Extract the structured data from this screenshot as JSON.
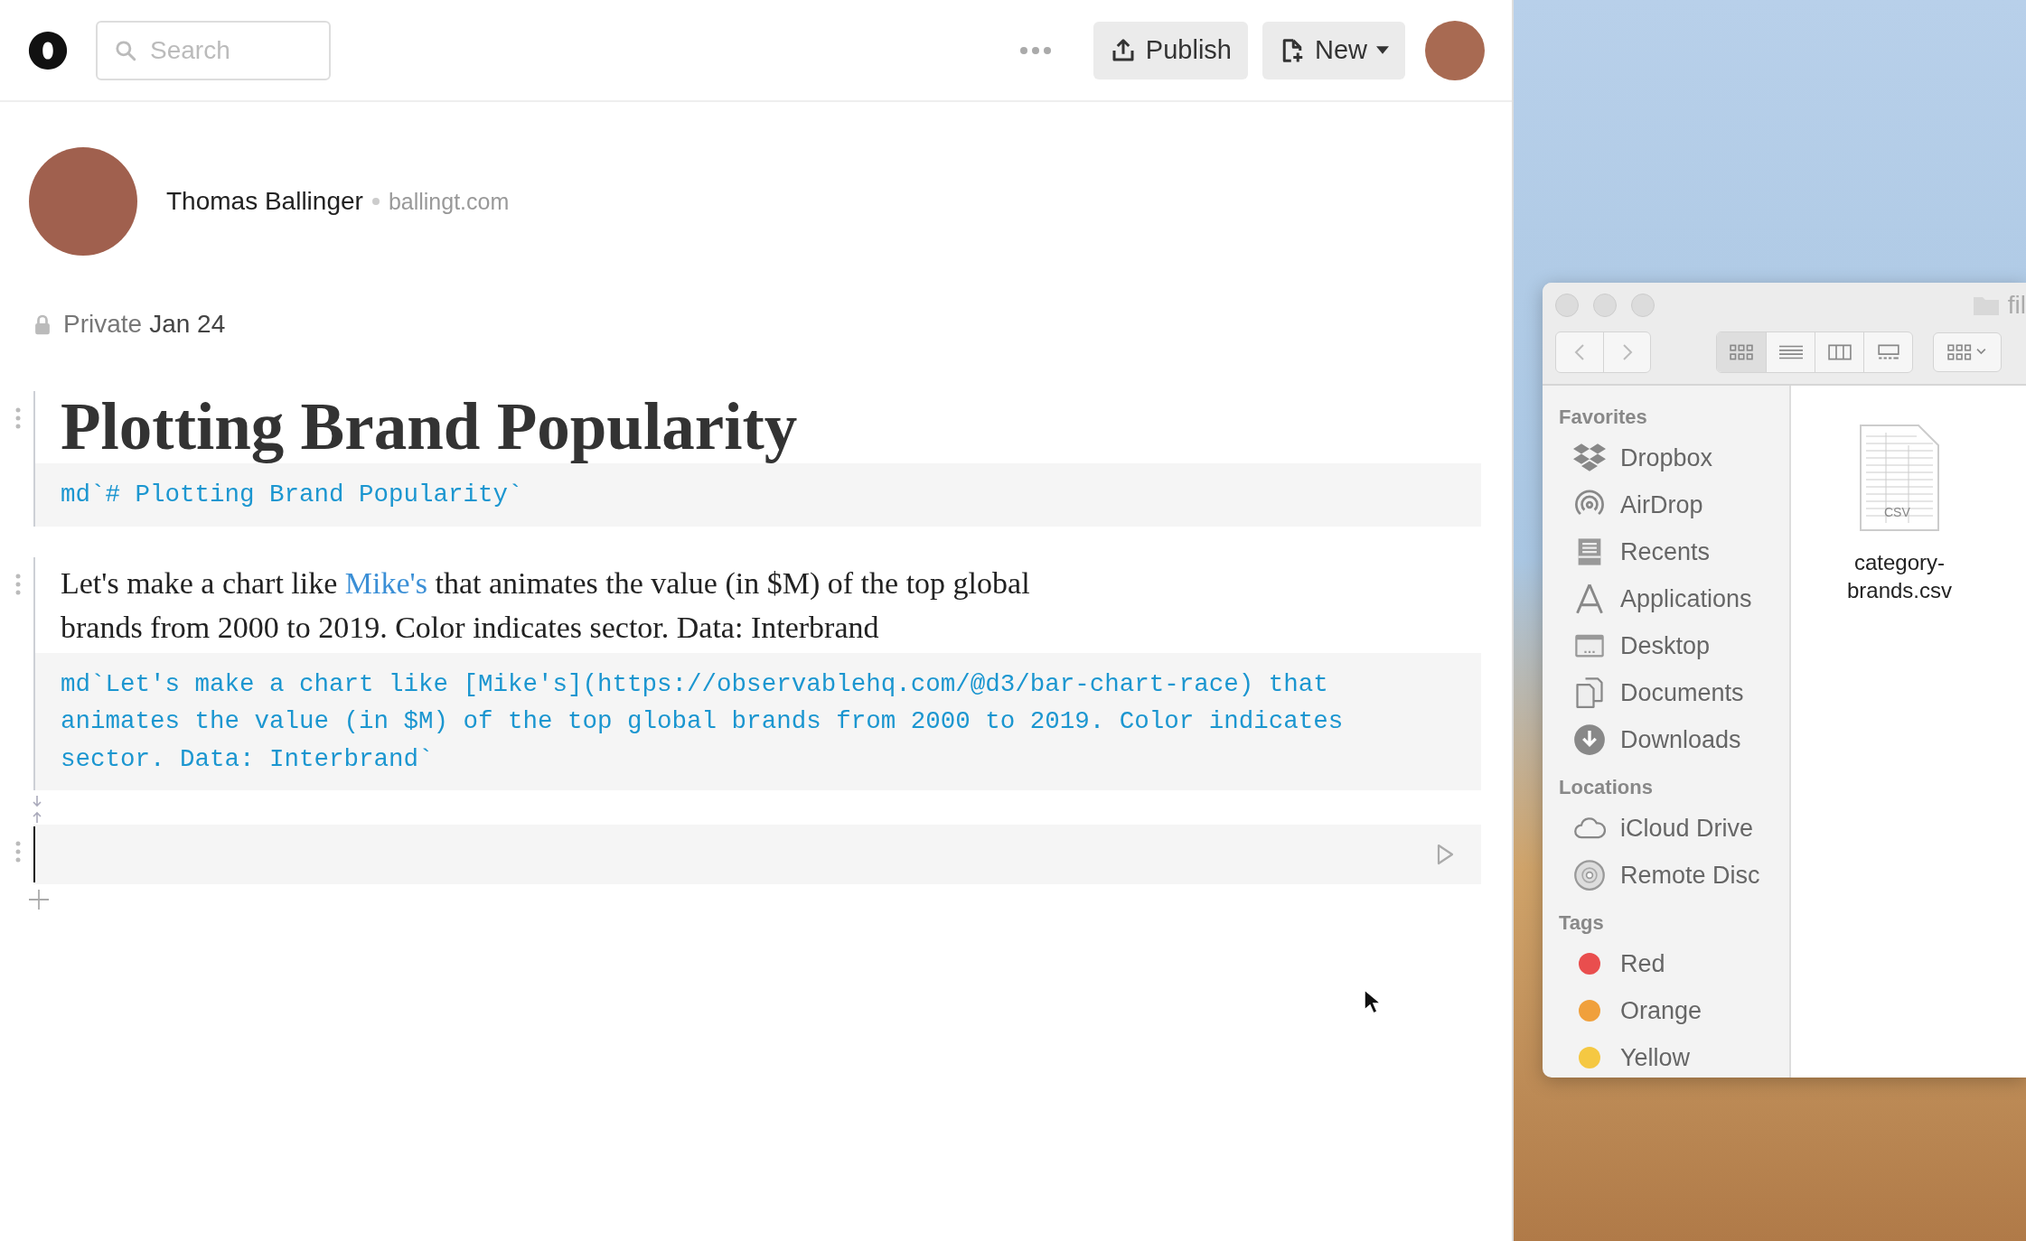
{
  "toolbar": {
    "search": {
      "placeholder": "Search"
    },
    "buttons": [
      {
        "label": "Publish",
        "kind": "publish"
      },
      {
        "label": "New",
        "kind": "new"
      }
    ]
  },
  "author": {
    "name": "Thomas Ballinger",
    "site": "ballingt.com"
  },
  "meta": {
    "visibility": "Private",
    "date": "Jan 24"
  },
  "cells": [
    {
      "kind": "heading",
      "output": "Plotting Brand Popularity",
      "source": "md`# Plotting Brand Popularity`"
    },
    {
      "kind": "paragraph",
      "output": {
        "before": "Let's make a chart like ",
        "link": "Mike's",
        "after": " that animates the value (in $M) of the top global brands from 2000 to 2019. Color indicates sector. Data: Interbrand"
      },
      "source": "md`Let's make a chart like [Mike's](https://observablehq.com/@d3/bar-chart-race) that animates the value (in $M) of the top global brands from 2000 to 2019. Color indicates sector. Data: Interbrand`"
    },
    {
      "kind": "empty",
      "focused": true
    }
  ],
  "finder": {
    "title": "fil",
    "views": [
      {
        "kind": "icons",
        "selected": true
      },
      {
        "kind": "list",
        "selected": false
      },
      {
        "kind": "columns",
        "selected": false
      },
      {
        "kind": "gallery",
        "selected": false
      }
    ],
    "sections": [
      {
        "heading": "Favorites",
        "items": [
          {
            "label": "Dropbox",
            "kind": "dropbox"
          },
          {
            "label": "AirDrop",
            "kind": "airdrop"
          },
          {
            "label": "Recents",
            "kind": "recents"
          },
          {
            "label": "Applications",
            "kind": "applications"
          },
          {
            "label": "Desktop",
            "kind": "desktop"
          },
          {
            "label": "Documents",
            "kind": "documents"
          },
          {
            "label": "Downloads",
            "kind": "downloads"
          }
        ]
      },
      {
        "heading": "Locations",
        "items": [
          {
            "label": "iCloud Drive",
            "kind": "cloud"
          },
          {
            "label": "Remote Disc",
            "kind": "disc"
          }
        ]
      },
      {
        "heading": "Tags",
        "items": [
          {
            "label": "Red",
            "kind": "tag",
            "color": "#e94e4e"
          },
          {
            "label": "Orange",
            "kind": "tag",
            "color": "#f0a03c"
          },
          {
            "label": "Yellow",
            "kind": "tag",
            "color": "#f5c842"
          }
        ]
      }
    ],
    "files": [
      {
        "name": "category-brands.csv",
        "badge": "CSV"
      }
    ]
  }
}
